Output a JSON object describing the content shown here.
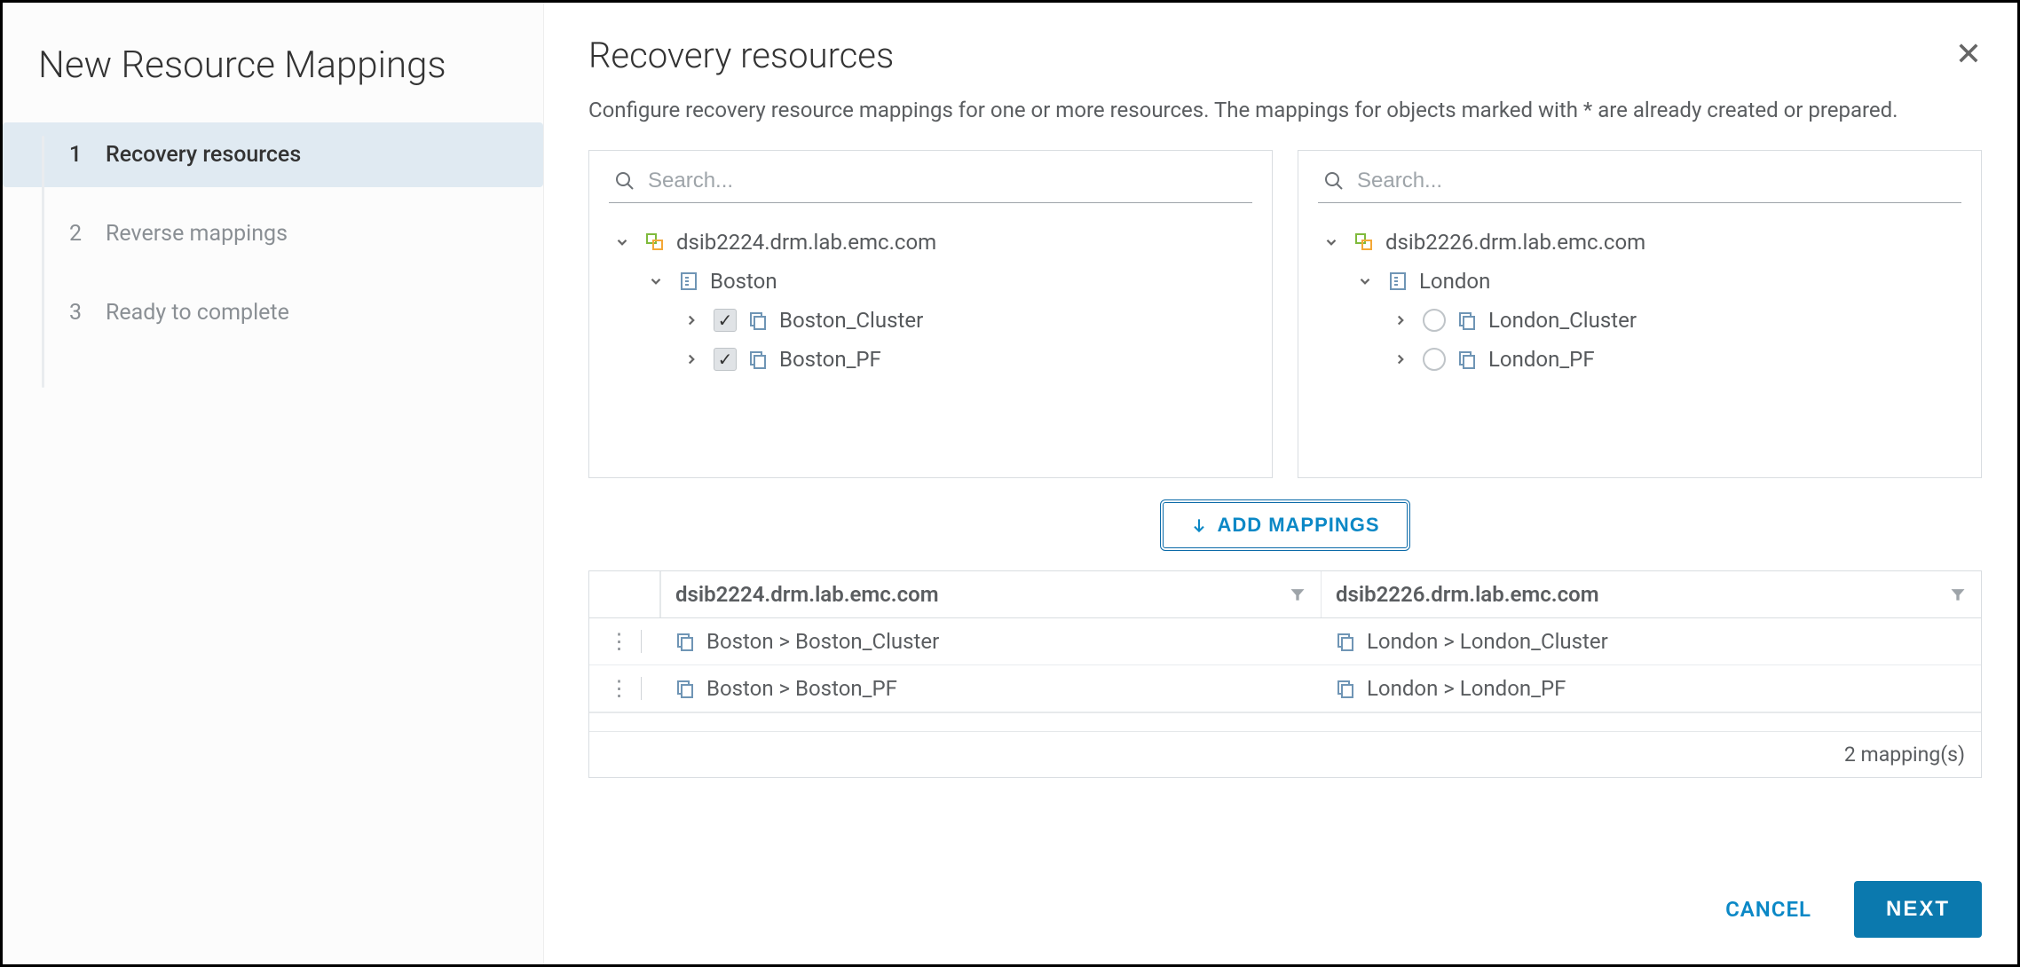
{
  "sidebar": {
    "title": "New Resource Mappings",
    "steps": [
      {
        "num": "1",
        "label": "Recovery resources",
        "active": true
      },
      {
        "num": "2",
        "label": "Reverse mappings",
        "active": false
      },
      {
        "num": "3",
        "label": "Ready to complete",
        "active": false
      }
    ]
  },
  "main": {
    "title": "Recovery resources",
    "description": "Configure recovery resource mappings for one or more resources. The mappings for objects marked with * are already created or prepared.",
    "add_mappings_label": "ADD MAPPINGS"
  },
  "left_panel": {
    "search_placeholder": "Search...",
    "vcenter": "dsib2224.drm.lab.emc.com",
    "datacenter": "Boston",
    "clusters": [
      {
        "name": "Boston_Cluster",
        "checked": true
      },
      {
        "name": "Boston_PF",
        "checked": true
      }
    ]
  },
  "right_panel": {
    "search_placeholder": "Search...",
    "vcenter": "dsib2226.drm.lab.emc.com",
    "datacenter": "London",
    "clusters": [
      {
        "name": "London_Cluster",
        "selected": false
      },
      {
        "name": "London_PF",
        "selected": false
      }
    ]
  },
  "table": {
    "headers": [
      "dsib2224.drm.lab.emc.com",
      "dsib2226.drm.lab.emc.com"
    ],
    "rows": [
      {
        "src": "Boston > Boston_Cluster",
        "dst": "London > London_Cluster"
      },
      {
        "src": "Boston > Boston_PF",
        "dst": "London > London_PF"
      }
    ],
    "footer": "2 mapping(s)"
  },
  "footer": {
    "cancel": "CANCEL",
    "next": "NEXT"
  }
}
